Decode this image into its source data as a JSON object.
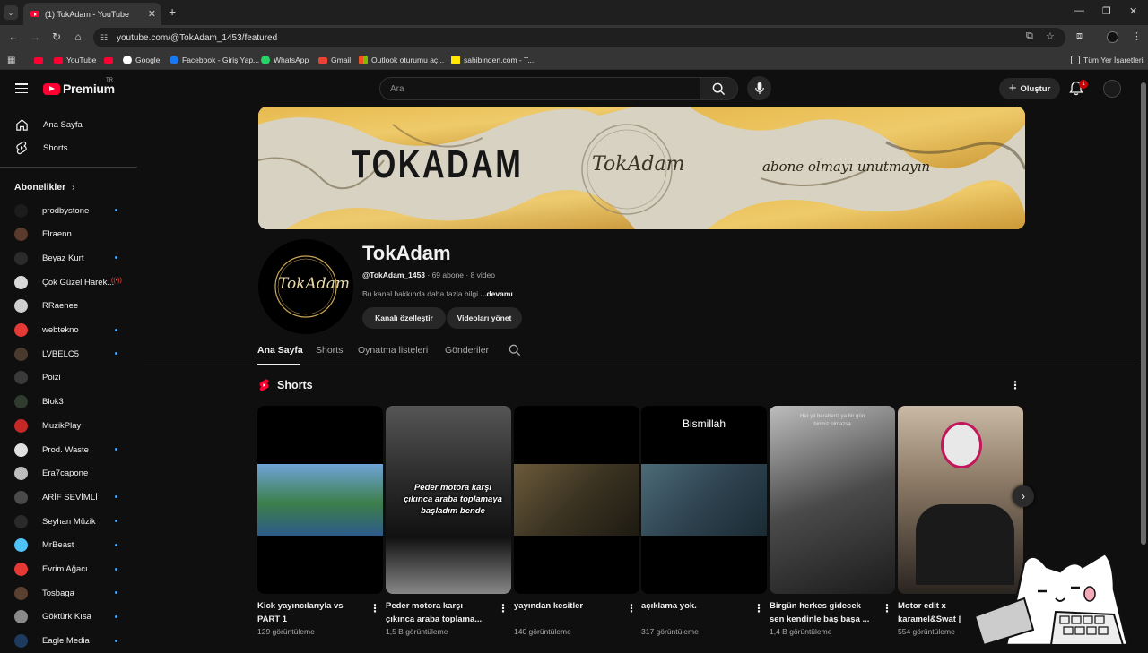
{
  "browser": {
    "tab_title": "(1) TokAdam - YouTube",
    "url": "youtube.com/@TokAdam_1453/featured",
    "bookmarks": [
      "YouTube",
      "Google",
      "Facebook - Giriş Yap...",
      "WhatsApp",
      "Gmail",
      "Outlook oturumu aç...",
      "sahibinden.com - T..."
    ],
    "all_bookmarks": "Tüm Yer İşaretleri"
  },
  "header": {
    "logo_text": "Premium",
    "logo_region": "TR",
    "search_placeholder": "Ara",
    "create_label": "Oluştur",
    "notification_count": "1"
  },
  "sidebar": {
    "main": [
      {
        "label": "Ana Sayfa",
        "icon": "home-icon"
      },
      {
        "label": "Shorts",
        "icon": "shorts-icon"
      }
    ],
    "subs_title": "Abonelikler",
    "subscriptions": [
      {
        "name": "prodbystone",
        "color": "#1c1c1c",
        "dot": true
      },
      {
        "name": "Elraenn",
        "color": "#5a3a2a",
        "dot": false
      },
      {
        "name": "Beyaz Kurt",
        "color": "#2b2b2b",
        "dot": true
      },
      {
        "name": "Çok Güzel Harek...",
        "color": "#d9d9d9",
        "live": true
      },
      {
        "name": "RRaenee",
        "color": "#cfcfcf",
        "dot": false
      },
      {
        "name": "webtekno",
        "color": "#e53935",
        "dot": true
      },
      {
        "name": "LVBELC5",
        "color": "#4a3a2e",
        "dot": true
      },
      {
        "name": "Poizi",
        "color": "#3a3a3a",
        "dot": false
      },
      {
        "name": "Blok3",
        "color": "#2e3b2e",
        "dot": false
      },
      {
        "name": "MuzikPlay",
        "color": "#c62828",
        "dot": false
      },
      {
        "name": "Prod. Waste",
        "color": "#e0e0e0",
        "dot": true
      },
      {
        "name": "Era7capone",
        "color": "#bdbdbd",
        "dot": false
      },
      {
        "name": "ARİF SEVİMLİ",
        "color": "#4a4a4a",
        "dot": true
      },
      {
        "name": "Seyhan Müzik",
        "color": "#2a2a2a",
        "dot": true
      },
      {
        "name": "MrBeast",
        "color": "#4fc3f7",
        "dot": true
      },
      {
        "name": "Evrim Ağacı",
        "color": "#e53935",
        "dot": true
      },
      {
        "name": "Tosbaga",
        "color": "#5a4030",
        "dot": true
      },
      {
        "name": "Göktürk Kısa",
        "color": "#8a8a8a",
        "dot": true
      },
      {
        "name": "Eagle Media",
        "color": "#1e3a5f",
        "dot": true
      }
    ]
  },
  "banner": {
    "text_big": "TOKADAM",
    "text_sign": "TokAdam",
    "text_tagline": "abone olmayı unutmayın"
  },
  "channel": {
    "name": "TokAdam",
    "handle": "@TokAdam_1453",
    "meta": " · 69 abone · 8 video",
    "desc": "Bu kanal hakkında daha fazla bilgi ",
    "desc_more": "...devamı",
    "customize_label": "Kanalı özelleştir",
    "manage_label": "Videoları yönet"
  },
  "tabs": [
    "Ana Sayfa",
    "Shorts",
    "Oynatma listeleri",
    "Gönderiler"
  ],
  "shorts": {
    "title": "Shorts",
    "items": [
      {
        "title": "Kick yayıncılarıyla vs PART 1",
        "views": "129 görüntüleme",
        "overlay": ""
      },
      {
        "title": "Peder motora karşı çıkınca araba toplama...",
        "views": "1,5 B görüntüleme",
        "overlay": "Peder motora karşı çıkınca araba toplamaya başladım bende"
      },
      {
        "title": "yayından kesitler",
        "views": "140 görüntüleme",
        "overlay": ""
      },
      {
        "title": "açıklama yok.",
        "views": "317 görüntüleme",
        "overlay": "Bismillah"
      },
      {
        "title": "Birgün herkes gidecek sen kendinle baş başa ...",
        "views": "1,4 B görüntüleme",
        "overlay": "Her yıl beraberiz ya bir gün birimiz olmazsa"
      },
      {
        "title": "Motor edit x karamel&Swat |",
        "views": "554 görüntüleme",
        "overlay": ""
      }
    ]
  }
}
